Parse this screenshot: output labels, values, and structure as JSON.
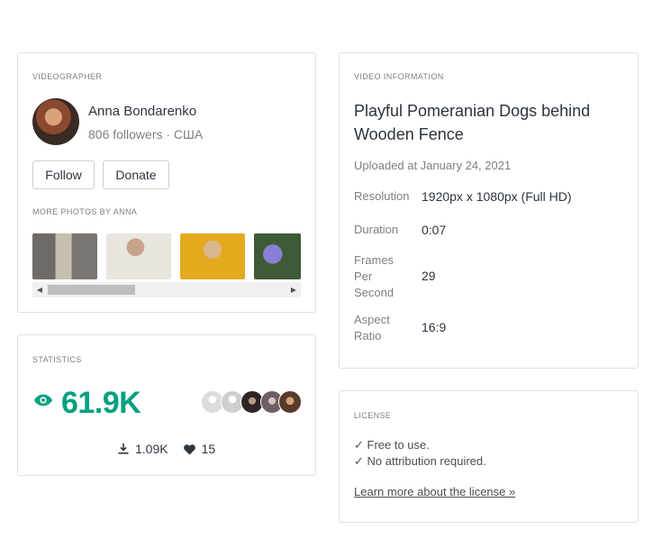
{
  "videographer": {
    "section_label": "VIDEOGRAPHER",
    "name": "Anna Bondarenko",
    "followers": "806 followers · США",
    "follow_label": "Follow",
    "donate_label": "Donate",
    "more_photos_label": "MORE PHOTOS BY ANNA"
  },
  "statistics": {
    "section_label": "STATISTICS",
    "views": "61.9K",
    "downloads": "1.09K",
    "likes": "15",
    "accent_color": "#05a081"
  },
  "video_info": {
    "section_label": "VIDEO INFORMATION",
    "title": "Playful Pomeranian Dogs behind Wooden Fence",
    "uploaded": "Uploaded at January 24, 2021",
    "rows": [
      {
        "key": "Resolution",
        "value": "1920px x 1080px (Full HD)"
      },
      {
        "key": "Duration",
        "value": "0:07"
      },
      {
        "key": "Frames Per Second",
        "value": "29"
      },
      {
        "key": "Aspect Ratio",
        "value": "16:9"
      }
    ]
  },
  "license": {
    "section_label": "LICENSE",
    "line1": "✓ Free to use.",
    "line2": "✓ No attribution required.",
    "link": "Learn more about the license »"
  },
  "icons": {
    "views": "eye-icon",
    "downloads": "download-icon",
    "likes": "heart-icon",
    "scroll_left": "arrow-left-icon",
    "scroll_right": "arrow-right-icon"
  }
}
